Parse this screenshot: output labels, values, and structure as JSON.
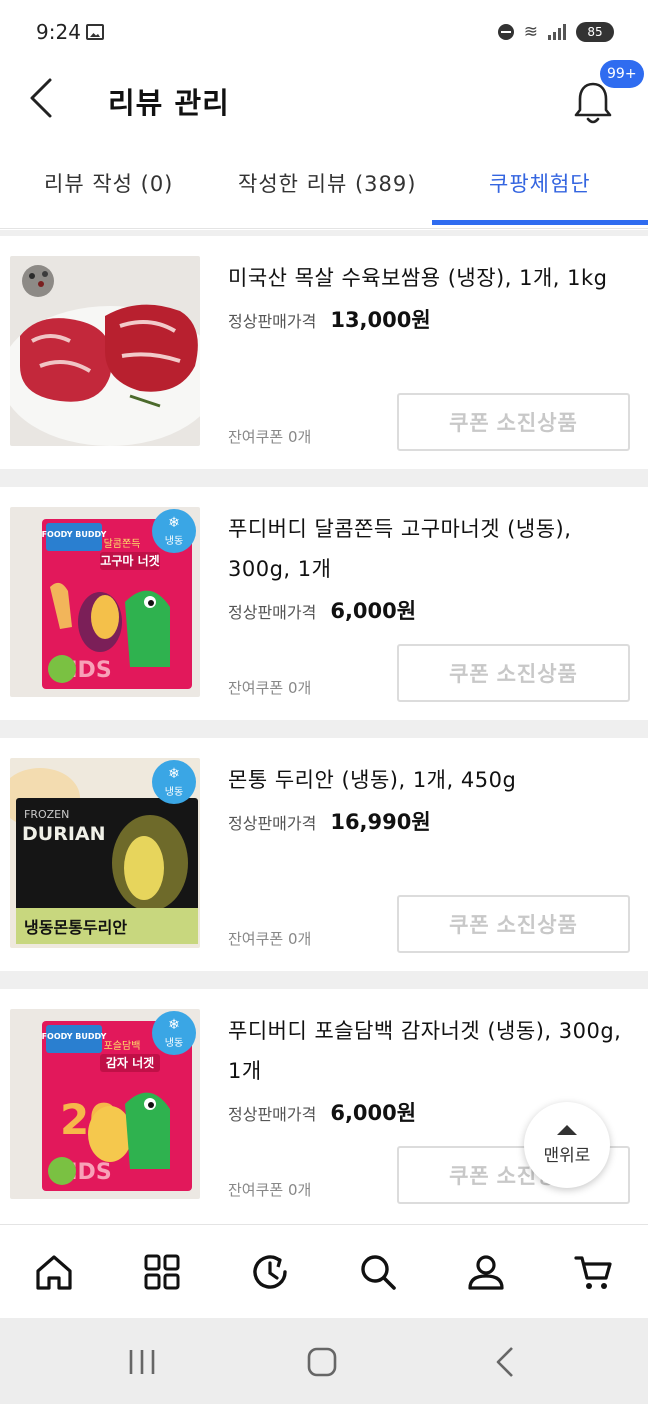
{
  "status_bar": {
    "time": "9:24",
    "battery": "85"
  },
  "header": {
    "title": "리뷰 관리",
    "notification_badge": "99+"
  },
  "tabs": [
    {
      "label": "리뷰 작성 (0)"
    },
    {
      "label": "작성한 리뷰 (389)"
    },
    {
      "label": "쿠팡체험단"
    }
  ],
  "products": [
    {
      "name": "미국산 목살 수육보쌈용 (냉장), 1개, 1kg",
      "price_label": "정상판매가격",
      "price": "13,000원",
      "coupon_left": "잔여쿠폰 0개",
      "coupon_button": "쿠폰 소진상품"
    },
    {
      "name": "푸디버디 달콤쫀득 고구마너겟 (냉동), 300g, 1개",
      "price_label": "정상판매가격",
      "price": "6,000원",
      "coupon_left": "잔여쿠폰 0개",
      "coupon_button": "쿠폰 소진상품"
    },
    {
      "name": "몬통 두리안 (냉동), 1개, 450g",
      "price_label": "정상판매가격",
      "price": "16,990원",
      "coupon_left": "잔여쿠폰 0개",
      "coupon_button": "쿠폰 소진상품"
    },
    {
      "name": "푸디버디 포슬담백 감자너겟 (냉동), 300g, 1개",
      "price_label": "정상판매가격",
      "price": "6,000원",
      "coupon_left": "잔여쿠폰 0개",
      "coupon_button": "쿠폰 소진상품"
    }
  ],
  "images": {
    "frozen_tag": "냉동",
    "foody_buddy": "FOODY BUDDY",
    "sweet_potato_title": "고구마 너겟",
    "sweet_potato_sub": "달콤쫀득",
    "kids": "KIDS",
    "durian_frozen": "FROZEN",
    "durian_word": "DURIAN",
    "durian_title": "냉동몬통두리안",
    "potato_title": "감자 너겟",
    "potato_sub": "포슬담백"
  },
  "scroll_top_button": {
    "label": "맨위로"
  },
  "bottom_nav": [
    "home-icon",
    "category-icon",
    "recent-icon",
    "search-icon",
    "user-icon",
    "cart-icon"
  ],
  "colors": {
    "accent": "#2f6cf0",
    "disabled_text": "#c8c8c8"
  }
}
